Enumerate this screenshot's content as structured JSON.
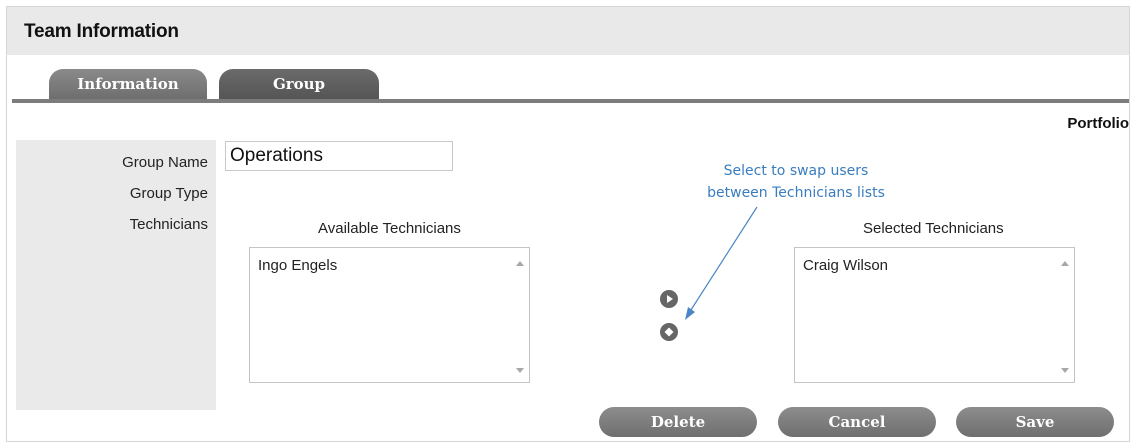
{
  "window": {
    "title": "Team Information"
  },
  "tabs": [
    {
      "label": "Information"
    },
    {
      "label": "Group"
    }
  ],
  "section": {
    "portfolio_label": "Portfolio"
  },
  "form": {
    "group_name_label": "Group Name",
    "group_name_value": "Operations",
    "group_type_label": "Group Type",
    "technicians_label": "Technicians"
  },
  "available": {
    "heading": "Available Technicians",
    "items": [
      "Ingo Engels"
    ]
  },
  "selected": {
    "heading": "Selected Technicians",
    "items": [
      "Craig Wilson"
    ]
  },
  "annotation": {
    "line1": "Select to swap users",
    "line2": "between Technicians lists",
    "color": "#3a7dbf"
  },
  "actions": {
    "delete_label": "Delete",
    "cancel_label": "Cancel",
    "save_label": "Save"
  },
  "icons": {
    "swap_right": "play-circle-icon",
    "swap_left": "diamond-circle-icon",
    "scroll_up": "triangle-up-icon",
    "scroll_down": "triangle-down-icon"
  }
}
